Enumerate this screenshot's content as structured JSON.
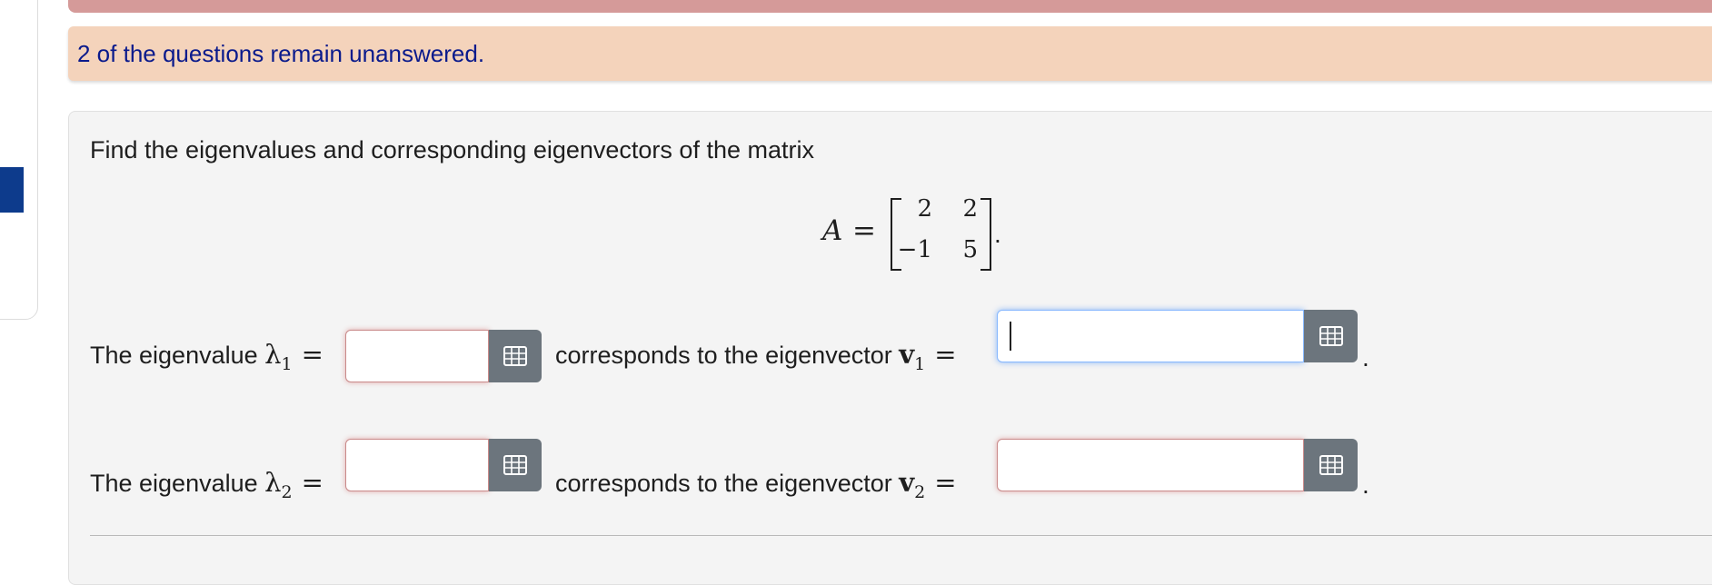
{
  "notice": {
    "text": "2 of the questions remain unanswered."
  },
  "question": {
    "prompt": "Find the eigenvalues and corresponding eigenvectors of the matrix",
    "matrix_name": "A",
    "equals": "=",
    "matrix": [
      [
        "2",
        "2"
      ],
      [
        "−1",
        "5"
      ]
    ],
    "matrix_end": "."
  },
  "rows": [
    {
      "label_prefix": "The eigenvalue ",
      "lambda_symbol": "λ",
      "lambda_sub": "1",
      "equals": "=",
      "mid_text": "corresponds to the eigenvector ",
      "vector_symbol": "v",
      "vector_sub": "1",
      "eigenvalue_value": "",
      "eigenvector_value": "",
      "end": "."
    },
    {
      "label_prefix": "The eigenvalue ",
      "lambda_symbol": "λ",
      "lambda_sub": "2",
      "equals": "=",
      "mid_text": "corresponds to the eigenvector ",
      "vector_symbol": "v",
      "vector_sub": "2",
      "eigenvalue_value": "",
      "eigenvector_value": "",
      "end": "."
    }
  ],
  "icons": {
    "matrix_button": "grid-icon"
  },
  "colors": {
    "notice_bg": "#f4d3bb",
    "notice_text": "#0a1a8c",
    "top_bar": "#d59a99",
    "button_bg": "#6c757d",
    "focus_border": "#86b7fe",
    "left_accent": "#0d3b8c"
  }
}
